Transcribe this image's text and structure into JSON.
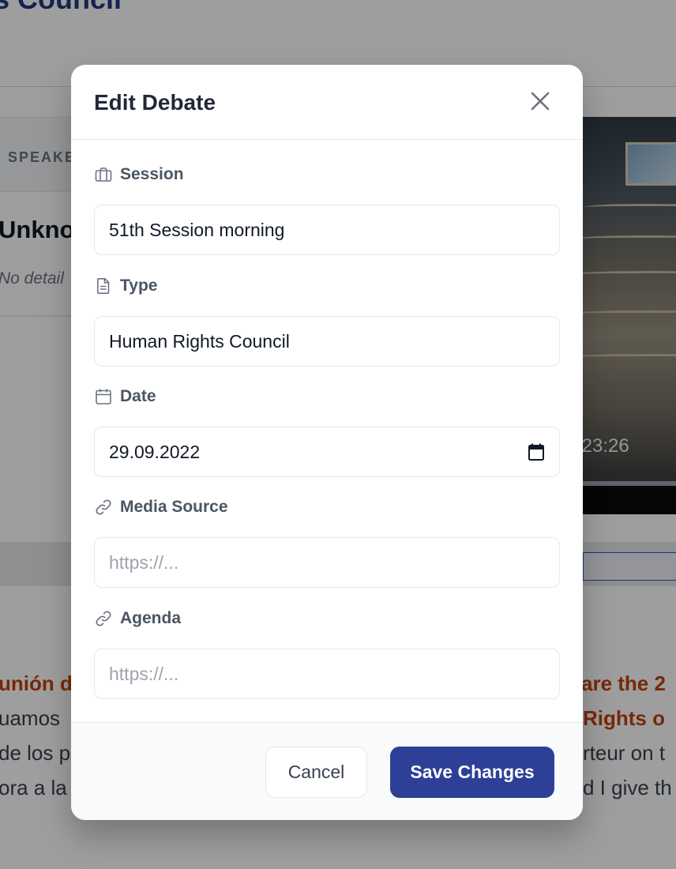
{
  "background": {
    "page_title": "s Council",
    "speaker_label": "SPEAKE",
    "speaker_name": "Unkno",
    "speaker_detail": "No detail",
    "video_time": ":23:26",
    "transcript_left": [
      "unión d",
      "uamos",
      "de los p",
      "ora a la"
    ],
    "transcript_right": [
      "are the 2",
      "Rights o",
      "rteur on t",
      "d I give th"
    ]
  },
  "modal": {
    "title": "Edit Debate",
    "close_icon": "close-icon",
    "fields": {
      "session": {
        "label": "Session",
        "icon": "briefcase-icon",
        "value": "51th Session morning",
        "placeholder": ""
      },
      "type": {
        "label": "Type",
        "icon": "document-icon",
        "value": "Human Rights Council",
        "placeholder": ""
      },
      "date": {
        "label": "Date",
        "icon": "calendar-icon",
        "value": "29.09.2022",
        "picker_icon": "calendar-picker-icon"
      },
      "media_source": {
        "label": "Media Source",
        "icon": "link-icon",
        "value": "",
        "placeholder": "https://..."
      },
      "agenda": {
        "label": "Agenda",
        "icon": "link-icon",
        "value": "",
        "placeholder": "https://..."
      }
    },
    "buttons": {
      "cancel": "Cancel",
      "save": "Save Changes"
    }
  },
  "colors": {
    "primary": "#2e3f97",
    "overlay": "rgba(0,0,0,0.38)",
    "accent_orange": "#c2410c"
  }
}
